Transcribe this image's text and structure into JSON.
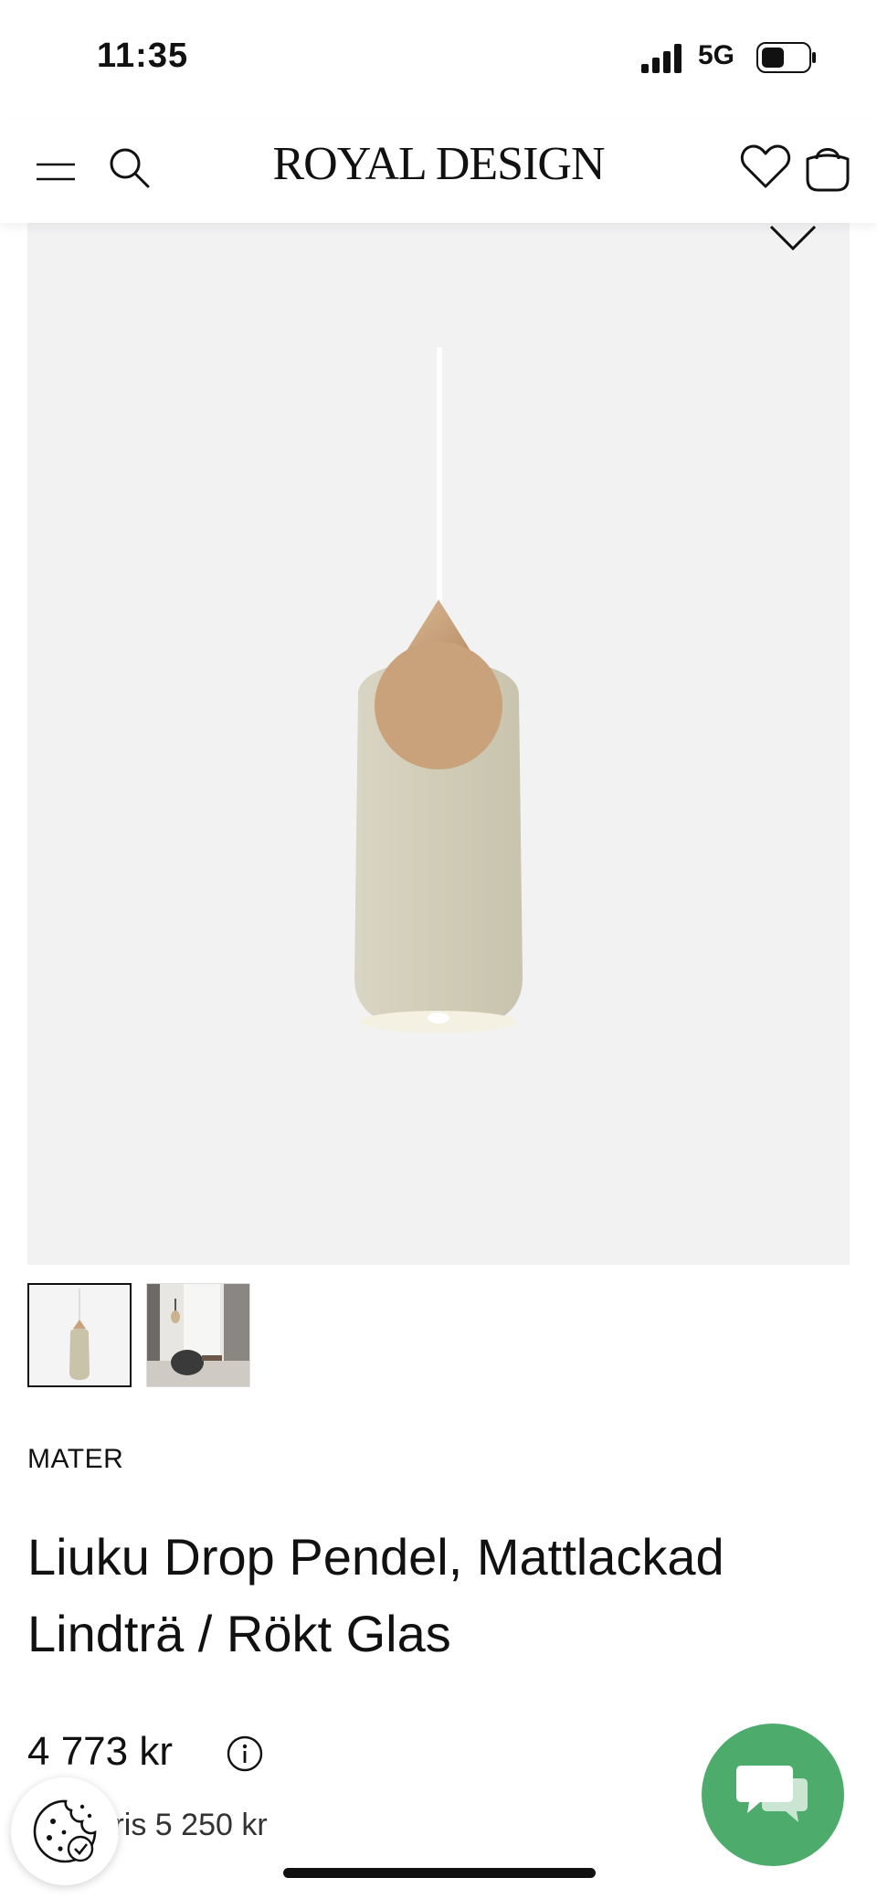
{
  "status_bar": {
    "time": "11:35",
    "network": "5G"
  },
  "nav": {
    "logo": "ROYAL DESIGN"
  },
  "product": {
    "brand": "MATER",
    "title": "Liuku Drop Pendel, Mattlackad Lindträ / Rökt Glas",
    "price": "4 773 kr",
    "original_price": "Ord. pris 5 250 kr"
  },
  "colors": {
    "accent": "#4dab6b",
    "text": "#111111",
    "image_background": "#f2f2f3"
  },
  "icons": {
    "menu": "hamburger-menu-icon",
    "search": "search-icon",
    "favorites": "heart-icon",
    "cart": "shopping-bag-icon",
    "info": "info-icon",
    "cookie": "cookie-icon",
    "chat": "chat-icon"
  }
}
